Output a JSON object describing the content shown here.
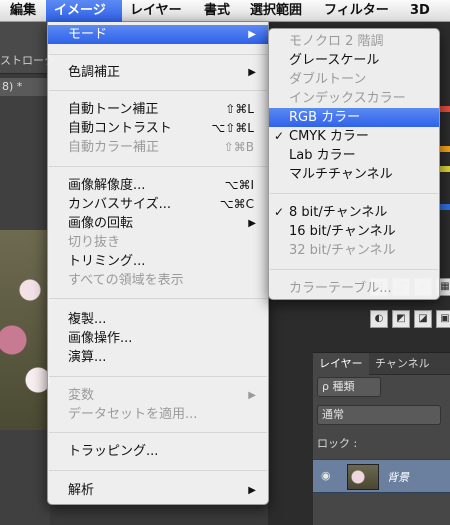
{
  "menubar": {
    "items": [
      {
        "label": "編集"
      },
      {
        "label": "イメージ"
      },
      {
        "label": "レイヤー"
      },
      {
        "label": "書式"
      },
      {
        "label": "選択範囲"
      },
      {
        "label": "フィルター"
      },
      {
        "label": "3D"
      }
    ]
  },
  "background": {
    "toolbar_text": "ストローク",
    "doc_tab": "8) *"
  },
  "image_menu": {
    "items": [
      {
        "label": "モード"
      },
      {
        "label": "色調補正"
      },
      {
        "label": "自動トーン補正",
        "shortcut": "⇧⌘L"
      },
      {
        "label": "自動コントラスト",
        "shortcut": "⌥⇧⌘L"
      },
      {
        "label": "自動カラー補正",
        "shortcut": "⇧⌘B"
      },
      {
        "label": "画像解像度...",
        "shortcut": "⌥⌘I"
      },
      {
        "label": "カンバスサイズ...",
        "shortcut": "⌥⌘C"
      },
      {
        "label": "画像の回転"
      },
      {
        "label": "切り抜き"
      },
      {
        "label": "トリミング..."
      },
      {
        "label": "すべての領域を表示"
      },
      {
        "label": "複製..."
      },
      {
        "label": "画像操作..."
      },
      {
        "label": "演算..."
      },
      {
        "label": "変数"
      },
      {
        "label": "データセットを適用..."
      },
      {
        "label": "トラッピング..."
      },
      {
        "label": "解析"
      }
    ]
  },
  "mode_submenu": {
    "items": [
      {
        "label": "モノクロ 2 階調"
      },
      {
        "label": "グレースケール"
      },
      {
        "label": "ダブルトーン"
      },
      {
        "label": "インデックスカラー"
      },
      {
        "label": "RGB カラー"
      },
      {
        "label": "CMYK カラー"
      },
      {
        "label": "Lab カラー"
      },
      {
        "label": "マルチチャンネル"
      },
      {
        "label": "8 bit/チャンネル"
      },
      {
        "label": "16 bit/チャンネル"
      },
      {
        "label": "32 bit/チャンネル"
      },
      {
        "label": "カラーテーブル..."
      }
    ],
    "check_mark": "✓"
  },
  "layers_panel": {
    "tabs": [
      {
        "label": "レイヤー"
      },
      {
        "label": "チャンネル"
      }
    ],
    "filter_label": "ρ 種類",
    "blend_mode": "通常",
    "lock_label": "ロック :",
    "layer_name": "背景"
  },
  "colors": {
    "highlight": "#3a6cf0",
    "menu_bg": "#f4f4f4",
    "disabled_text": "#9a9a9a"
  }
}
